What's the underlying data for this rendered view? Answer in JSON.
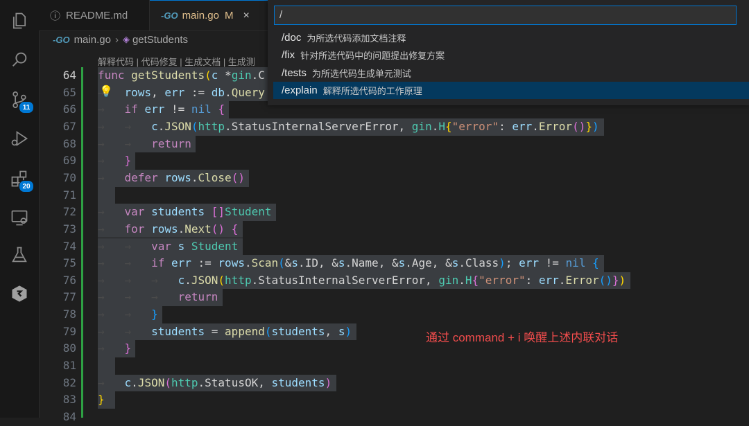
{
  "tabs": [
    {
      "icon": "info-icon",
      "label": "README.md"
    },
    {
      "icon": "go-file-icon",
      "label": "main.go",
      "modified": "M",
      "close": "×"
    }
  ],
  "breadcrumb": {
    "file": "main.go",
    "symbol": "getStudents"
  },
  "codelens": "解释代码 | 代码修复 | 生成文档 | 生成测",
  "activity_badges": {
    "source_control": "11",
    "extensions": "20"
  },
  "line_numbers": [
    "64",
    "65",
    "66",
    "67",
    "68",
    "69",
    "70",
    "71",
    "72",
    "73",
    "74",
    "75",
    "76",
    "77",
    "78",
    "79",
    "80",
    "81",
    "82",
    "83",
    "84"
  ],
  "quick_input": {
    "value": "/",
    "items": [
      {
        "cmd": "/doc",
        "desc": "为所选代码添加文档注释"
      },
      {
        "cmd": "/fix",
        "desc": "针对所选代码中的问题提出修复方案"
      },
      {
        "cmd": "/tests",
        "desc": "为所选代码生成单元测试"
      },
      {
        "cmd": "/explain",
        "desc": "解释所选代码的工作原理",
        "selected": true
      }
    ]
  },
  "annotation": "通过 command + i 唤醒上述内联对话",
  "code_lines": [
    "func getStudents(c *gin.C",
    "    rows, err := db.Query",
    "    if err != nil {",
    "        c.JSON(http.StatusInternalServerError, gin.H{\"error\": err.Error()})",
    "        return",
    "    }",
    "    defer rows.Close()",
    "",
    "    var students []Student",
    "    for rows.Next() {",
    "        var s Student",
    "        if err := rows.Scan(&s.ID, &s.Name, &s.Age, &s.Class); err != nil {",
    "            c.JSON(http.StatusInternalServerError, gin.H{\"error\": err.Error()})",
    "            return",
    "        }",
    "        students = append(students, s)",
    "    }",
    "",
    "    c.JSON(http.StatusOK, students)",
    "}",
    ""
  ]
}
